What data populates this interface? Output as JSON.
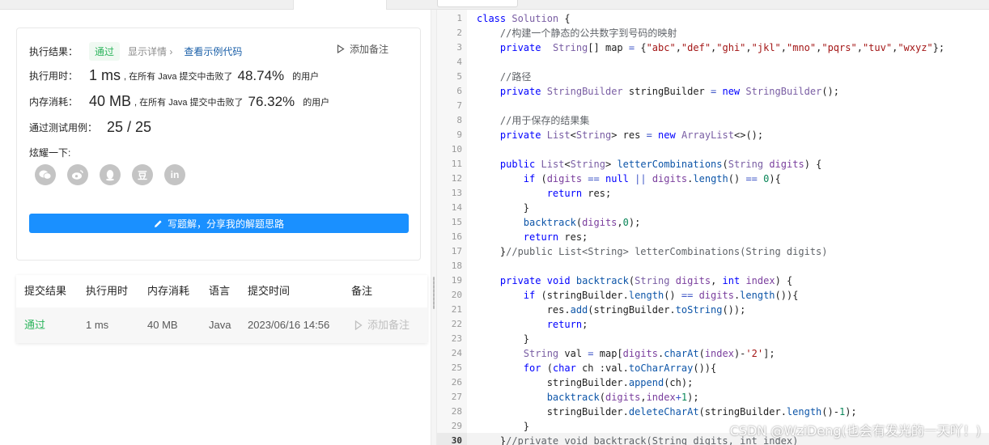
{
  "result": {
    "label": "执行结果：",
    "status": "通过",
    "show_details": "显示详情 ›",
    "view_example": "查看示例代码",
    "add_note": "添加备注"
  },
  "runtime": {
    "label": "执行用时：",
    "value": "1 ms",
    "beat_prefix": ", 在所有 Java 提交中击败了",
    "percent": "48.74%",
    "suffix": "的用户"
  },
  "memory": {
    "label": "内存消耗：",
    "value": "40 MB",
    "beat_prefix": ", 在所有 Java 提交中击败了",
    "percent": "76.32%",
    "suffix": "的用户"
  },
  "tests": {
    "label": "通过测试用例：",
    "value": "25 / 25"
  },
  "share": {
    "label": "炫耀一下:",
    "icons": [
      "wechat-icon",
      "weibo-icon",
      "qq-icon",
      "douban-icon",
      "linkedin-icon"
    ],
    "douban_glyph": "豆",
    "linkedin_glyph": "in"
  },
  "write_solution": "写题解，分享我的解题思路",
  "submissions": {
    "headers": [
      "提交结果",
      "执行用时",
      "内存消耗",
      "语言",
      "提交时间",
      "备注"
    ],
    "row": {
      "status": "通过",
      "runtime": "1 ms",
      "memory": "40 MB",
      "language": "Java",
      "time": "2023/06/16 14:56",
      "note": "添加备注"
    }
  },
  "editor": {
    "current_line": 30,
    "lines": [
      "class Solution {",
      "    //构建一个静态的公共数字到号码的映射",
      "    private  String[] map = {\"abc\",\"def\",\"ghi\",\"jkl\",\"mno\",\"pqrs\",\"tuv\",\"wxyz\"};",
      "",
      "    //路径",
      "    private StringBuilder stringBuilder = new StringBuilder();",
      "",
      "    //用于保存的结果集",
      "    private List<String> res = new ArrayList<>();",
      "",
      "    public List<String> letterCombinations(String digits) {",
      "        if (digits == null || digits.length() == 0){",
      "            return res;",
      "        }",
      "        backtrack(digits,0);",
      "        return res;",
      "    }//public List<String> letterCombinations(String digits)",
      "",
      "    private void backtrack(String digits, int index) {",
      "        if (stringBuilder.length() == digits.length()){",
      "            res.add(stringBuilder.toString());",
      "            return;",
      "        }",
      "        String val = map[digits.charAt(index)-'2'];",
      "        for (char ch :val.toCharArray()){",
      "            stringBuilder.append(ch);",
      "            backtrack(digits,index+1);",
      "            stringBuilder.deleteCharAt(stringBuilder.length()-1);",
      "        }",
      "    }//private void backtrack(String digits, int index)"
    ]
  },
  "watermark": "CSDN @WziDeng(也会有发光的一天吖！)"
}
